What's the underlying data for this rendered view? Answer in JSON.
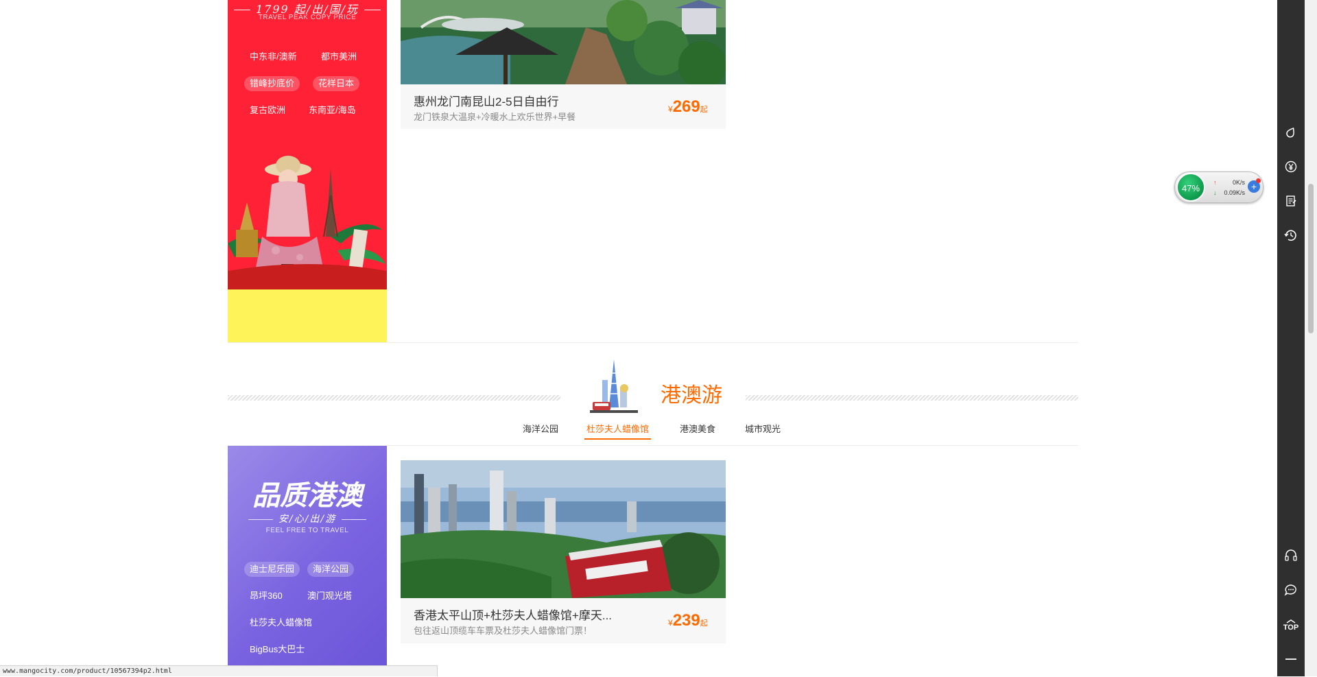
{
  "top_banner": {
    "title": "1799 起/出/国/玩",
    "subtitle": "TRAVEL PEAK COPY PRICE",
    "tags": [
      {
        "label": "中东非/澳新",
        "highlight": false
      },
      {
        "label": "都市美洲",
        "highlight": false
      },
      {
        "label": "错峰抄底价",
        "highlight": true
      },
      {
        "label": "花样日本",
        "highlight": true
      },
      {
        "label": "复古欧洲",
        "highlight": false
      },
      {
        "label": "东南亚/海岛",
        "highlight": false
      }
    ],
    "bg_color": "#ff2236",
    "accent_color": "#fff35a"
  },
  "product_top": {
    "name": "惠州龙门南昆山2-5日自由行",
    "desc": "龙门铁泉大温泉+冷暖水上欢乐世界+早餐",
    "currency": "¥",
    "price": "269",
    "suffix": "起"
  },
  "section": {
    "title": "港澳游",
    "tabs": [
      {
        "label": "海洋公园",
        "active": false
      },
      {
        "label": "杜莎夫人蜡像馆",
        "active": true
      },
      {
        "label": "港澳美食",
        "active": false
      },
      {
        "label": "城市观光",
        "active": false
      }
    ]
  },
  "hk_banner": {
    "title": "品质港澳",
    "subtitle": "安/心/出/游",
    "subtitle_en": "FEEL FREE TO TRAVEL",
    "tags": [
      {
        "label": "迪士尼乐园",
        "highlight": true
      },
      {
        "label": "海洋公园",
        "highlight": true
      },
      {
        "label": "昂坪360",
        "highlight": false
      },
      {
        "label": "澳门观光塔",
        "highlight": false
      },
      {
        "label": "杜莎夫人蜡像馆",
        "highlight": false
      },
      {
        "label": "BigBus大巴士",
        "highlight": false
      }
    ]
  },
  "product_hk": {
    "name": "香港太平山顶+杜莎夫人蜡像馆+摩天...",
    "desc": "包往返山顶缆车车票及杜莎夫人蜡像馆门票！",
    "currency": "¥",
    "price": "239",
    "suffix": "起"
  },
  "net_widget": {
    "percent": "47%",
    "up": "0K/s",
    "down": "0.09K/s"
  },
  "toolbar": {
    "icons": [
      "droplet-icon",
      "yen-icon",
      "notes-icon",
      "history-icon",
      "headset-icon",
      "chat-icon",
      "top-icon",
      "minimize-icon"
    ],
    "top_label": "TOP"
  },
  "status_bar": {
    "url": "www.mangocity.com/product/10567394p2.html"
  },
  "colors": {
    "orange": "#ff6a00",
    "toolbar": "#2f2f2f",
    "purple": "#7a63e0"
  }
}
